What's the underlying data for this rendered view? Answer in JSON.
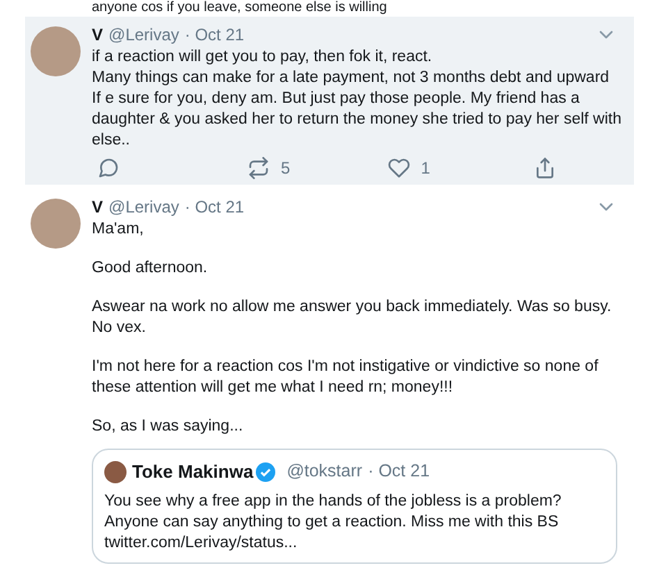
{
  "top_fragment": "anyone cos if you leave, someone else is willing",
  "tweets": [
    {
      "highlighted": true,
      "name": "V",
      "handle": "@Lerivay",
      "date": "· Oct 21",
      "paragraphs": [
        "if a reaction will get you to pay, then fok it, react.\nMany things can make for a late payment, not 3 months debt and upward\nIf e sure for you, deny am. But just pay those people. My friend has a daughter & you asked her to return the money she tried to pay her self with else.."
      ],
      "actions": {
        "retweets": "5",
        "likes": "1"
      }
    },
    {
      "highlighted": false,
      "name": "V",
      "handle": "@Lerivay",
      "date": "· Oct 21",
      "paragraphs": [
        "Ma'am,",
        "Good afternoon.",
        "Aswear na work no allow me answer you back immediately. Was so busy. No vex.",
        "I'm not here for a reaction cos I'm not instigative or vindictive so none of these attention will get me what I need rn; money!!!",
        "So, as I was saying..."
      ],
      "quote": {
        "name": "Toke Makinwa",
        "verified": true,
        "handle": "@tokstarr",
        "date": "· Oct 21",
        "text": "You see why a free app in the hands of the jobless is a problem? Anyone can say anything to get a reaction. Miss me with this BS twitter.com/Lerivay/status..."
      }
    }
  ]
}
